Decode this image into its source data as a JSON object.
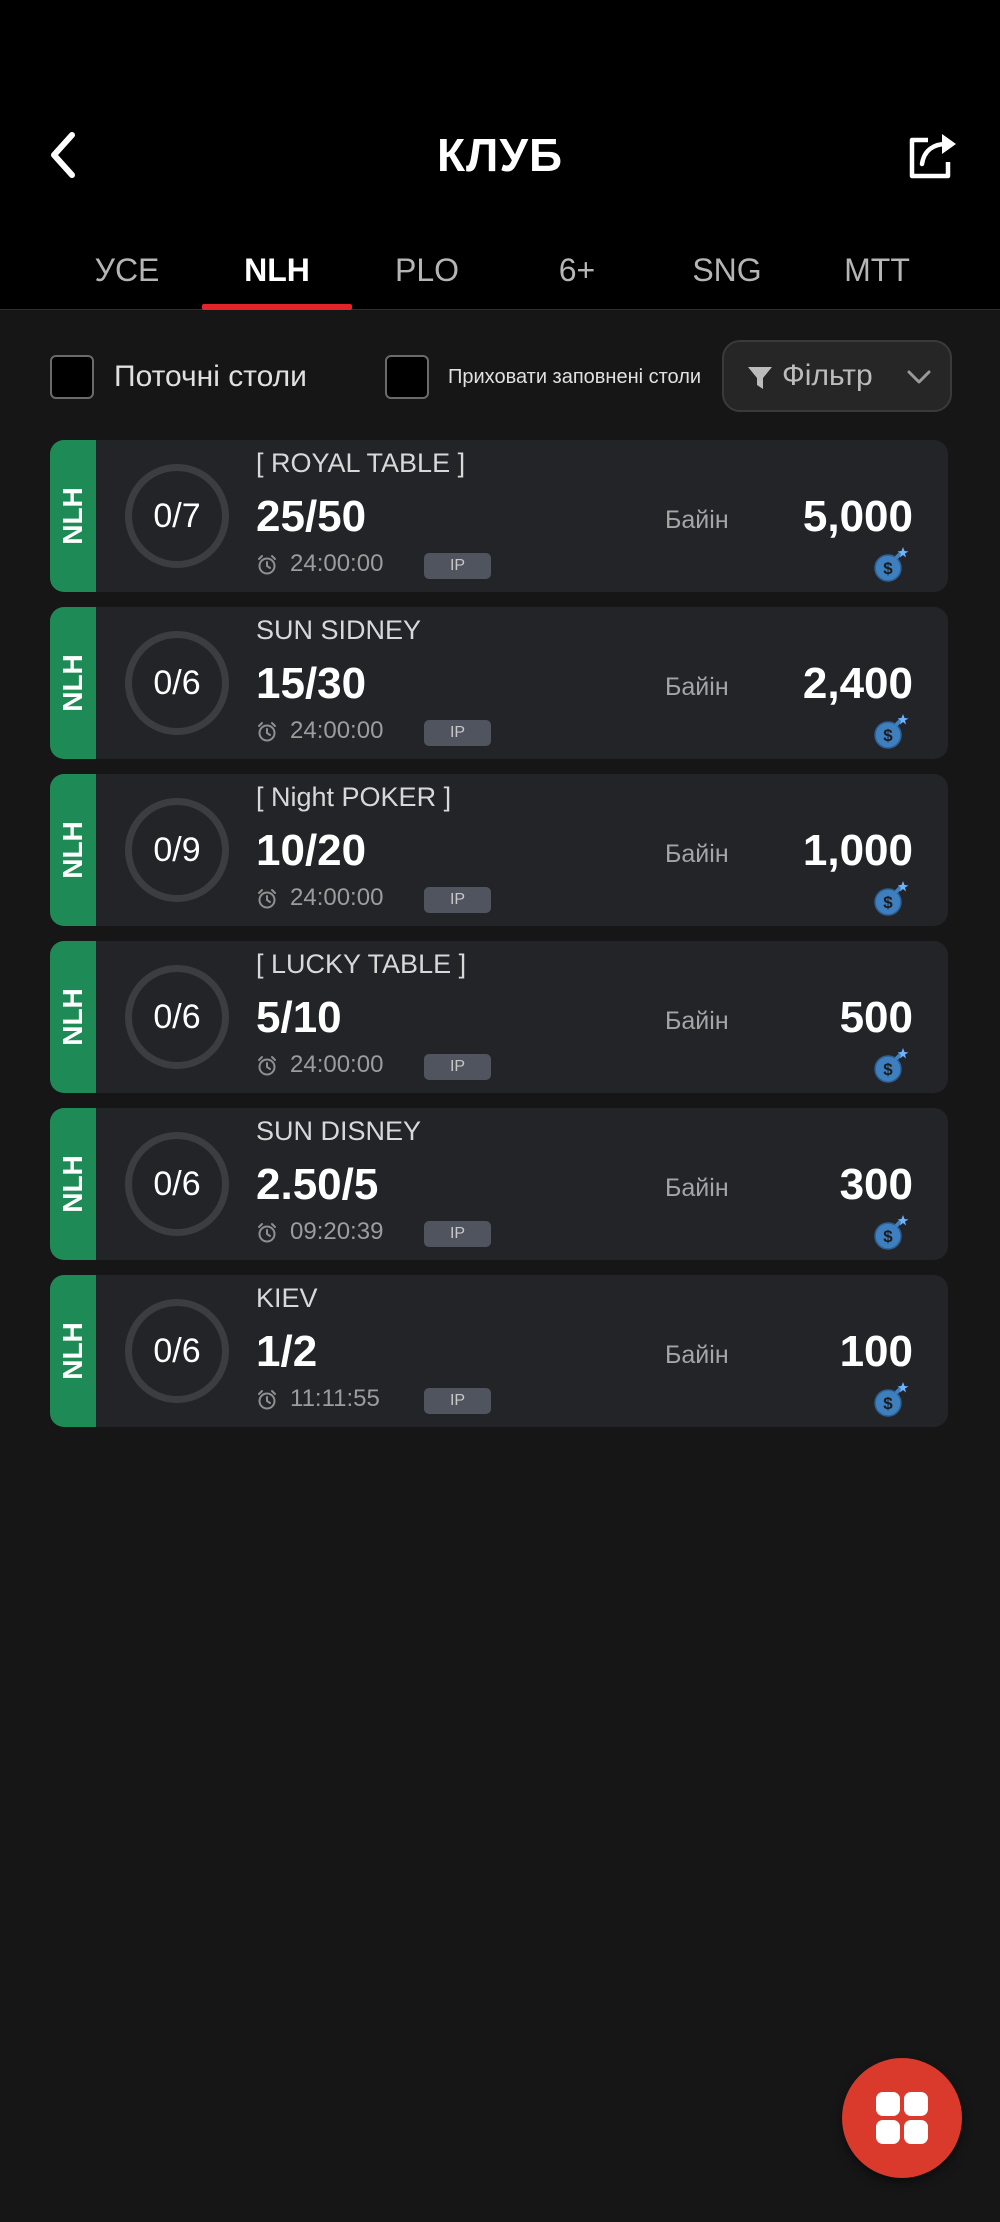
{
  "header": {
    "title": "КЛУБ",
    "back_icon": "chevron-left-icon",
    "share_icon": "share-icon"
  },
  "tabs": [
    {
      "label": "УСЕ",
      "active": false
    },
    {
      "label": "NLH",
      "active": true
    },
    {
      "label": "PLO",
      "active": false
    },
    {
      "label": "6+",
      "active": false
    },
    {
      "label": "SNG",
      "active": false
    },
    {
      "label": "MTT",
      "active": false
    }
  ],
  "filters": {
    "current_tables_label": "Поточні столи",
    "current_tables_checked": false,
    "hide_full_label": "Приховати заповнені столи",
    "hide_full_checked": false,
    "filter_label": "Фільтр"
  },
  "tables": [
    {
      "game": "NLH",
      "seats": "0/7",
      "name": "[ ROYAL TABLE ]",
      "blinds": "25/50",
      "time": "24:00:00",
      "tag": "IP",
      "buyin_label": "Байін",
      "buyin": "5,000"
    },
    {
      "game": "NLH",
      "seats": "0/6",
      "name": "SUN SIDNEY",
      "blinds": "15/30",
      "time": "24:00:00",
      "tag": "IP",
      "buyin_label": "Байін",
      "buyin": "2,400"
    },
    {
      "game": "NLH",
      "seats": "0/9",
      "name": "[ Night POKER ]",
      "blinds": "10/20",
      "time": "24:00:00",
      "tag": "IP",
      "buyin_label": "Байін",
      "buyin": "1,000"
    },
    {
      "game": "NLH",
      "seats": "0/6",
      "name": "[ LUCKY TABLE ]",
      "blinds": "5/10",
      "time": "24:00:00",
      "tag": "IP",
      "buyin_label": "Байін",
      "buyin": "500"
    },
    {
      "game": "NLH",
      "seats": "0/6",
      "name": "SUN DISNEY",
      "blinds": "2.50/5",
      "time": "09:20:39",
      "tag": "IP",
      "buyin_label": "Байін",
      "buyin": "300"
    },
    {
      "game": "NLH",
      "seats": "0/6",
      "name": "KIEV",
      "blinds": "1/2",
      "time": "11:11:55",
      "tag": "IP",
      "buyin_label": "Байін",
      "buyin": "100"
    }
  ],
  "colors": {
    "accent": "#e2242a",
    "badge_green": "#1e8a55",
    "fab": "#d93a2c"
  }
}
